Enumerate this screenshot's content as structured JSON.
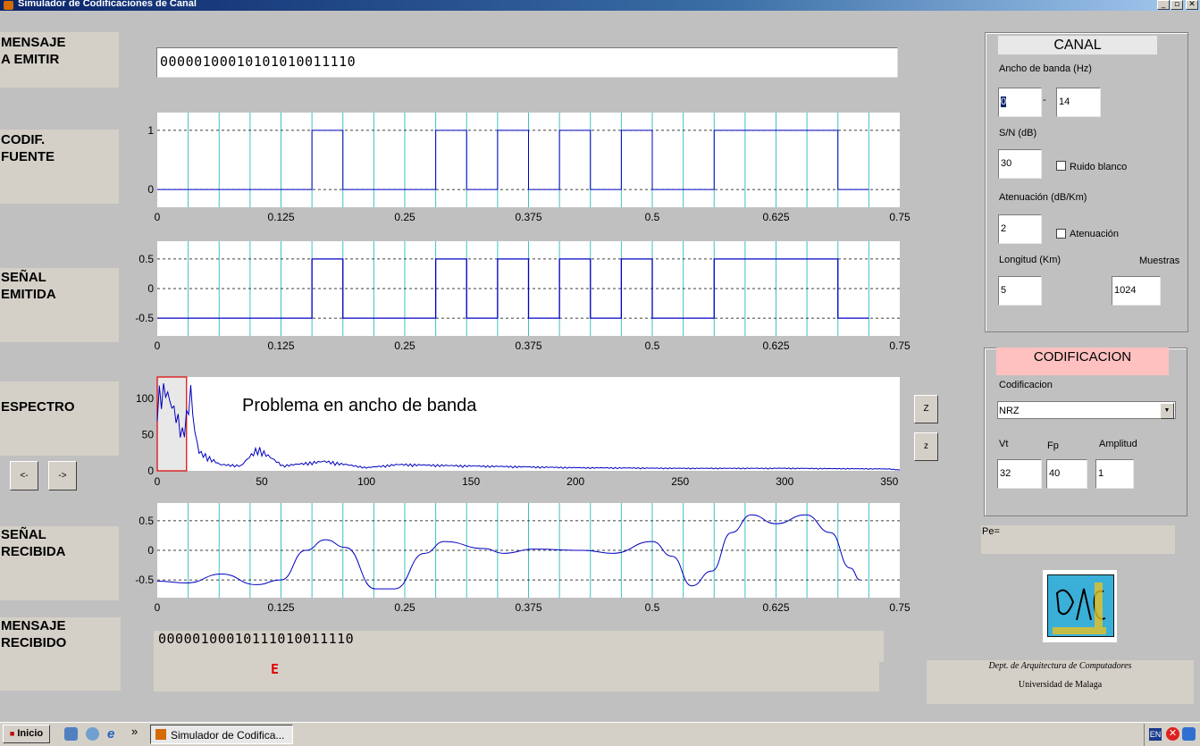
{
  "window": {
    "title": "Simulador de Codificaciones de Canal",
    "controls": [
      "_",
      "▫",
      "✕"
    ]
  },
  "left": {
    "mensaje_emitir": "MENSAJE\nA EMITIR",
    "codif_fuente": "CODIF.\nFUENTE",
    "senal_emitida": "SEÑAL\nEMITIDA",
    "espectro": "ESPECTRO",
    "senal_recibida": "SEÑAL\nRECIBIDA",
    "mensaje_recibido": "MENSAJE\nRECIBIDO",
    "prev_button": "<-",
    "next_button": "->"
  },
  "message_input": {
    "value": "00000100010101010011110"
  },
  "received": {
    "value": "00000100010111010011110",
    "error_mark": "E"
  },
  "plots": {
    "time_ticks": [
      "0",
      "0.125",
      "0.25",
      "0.375",
      "0.5",
      "0.625",
      "0.75"
    ],
    "codif_y_ticks": [
      "1",
      "0"
    ],
    "emit_y_ticks": [
      "0.5",
      "0",
      "-0.5"
    ],
    "spectrum_x_ticks": [
      "0",
      "50",
      "100",
      "150",
      "200",
      "250",
      "300",
      "350"
    ],
    "spectrum_y_ticks": [
      "100",
      "50",
      "0"
    ],
    "recv_y_ticks": [
      "0.5",
      "0",
      "-0.5"
    ],
    "annotation": "Problema en ancho de banda",
    "zoom_in": "Z",
    "zoom_out": "z"
  },
  "chart_data": [
    {
      "type": "line",
      "name": "codif-fuente",
      "step": true,
      "bits": [
        0,
        0,
        0,
        0,
        0,
        1,
        0,
        0,
        0,
        1,
        0,
        1,
        0,
        1,
        0,
        1,
        0,
        0,
        1,
        1,
        1,
        1,
        0
      ],
      "bit_duration": 0.03125,
      "ylim": [
        -0.3,
        1.3
      ],
      "xlim": [
        0,
        0.75
      ],
      "grid_y": [
        1,
        0
      ]
    },
    {
      "type": "line",
      "name": "senal-emitida",
      "step": true,
      "encoding": "NRZ",
      "levels": [
        -0.5,
        0.5
      ],
      "xlim": [
        0,
        0.75
      ],
      "ylim": [
        -0.8,
        0.8
      ]
    },
    {
      "type": "line",
      "name": "espectro",
      "xlim": [
        0,
        355
      ],
      "ylim": [
        0,
        130
      ],
      "band_highlight": [
        0,
        14
      ],
      "peaks": [
        [
          0,
          115
        ],
        [
          2,
          122
        ],
        [
          4,
          128
        ],
        [
          6,
          110
        ],
        [
          8,
          95
        ],
        [
          10,
          80
        ],
        [
          12,
          60
        ],
        [
          14,
          85
        ],
        [
          16,
          125
        ],
        [
          18,
          60
        ],
        [
          20,
          30
        ],
        [
          25,
          20
        ],
        [
          30,
          10
        ],
        [
          40,
          8
        ],
        [
          48,
          35
        ],
        [
          60,
          8
        ],
        [
          80,
          15
        ],
        [
          100,
          5
        ],
        [
          115,
          10
        ],
        [
          145,
          8
        ],
        [
          200,
          5
        ],
        [
          250,
          4
        ],
        [
          300,
          4
        ],
        [
          350,
          3
        ]
      ]
    },
    {
      "type": "line",
      "name": "senal-recibida",
      "xlim": [
        0,
        0.75
      ],
      "ylim": [
        -0.8,
        0.8
      ],
      "points": [
        [
          0,
          -0.52
        ],
        [
          0.03,
          -0.55
        ],
        [
          0.065,
          -0.4
        ],
        [
          0.1,
          -0.58
        ],
        [
          0.125,
          -0.5
        ],
        [
          0.15,
          0.0
        ],
        [
          0.17,
          0.18
        ],
        [
          0.19,
          0.05
        ],
        [
          0.22,
          -0.65
        ],
        [
          0.24,
          -0.65
        ],
        [
          0.27,
          -0.05
        ],
        [
          0.29,
          0.15
        ],
        [
          0.33,
          0.03
        ],
        [
          0.35,
          -0.05
        ],
        [
          0.38,
          0.02
        ],
        [
          0.43,
          0.0
        ],
        [
          0.46,
          -0.05
        ],
        [
          0.5,
          0.15
        ],
        [
          0.52,
          -0.1
        ],
        [
          0.54,
          -0.6
        ],
        [
          0.56,
          -0.35
        ],
        [
          0.58,
          0.3
        ],
        [
          0.6,
          0.6
        ],
        [
          0.625,
          0.45
        ],
        [
          0.655,
          0.6
        ],
        [
          0.68,
          0.3
        ],
        [
          0.7,
          -0.3
        ],
        [
          0.71,
          -0.5
        ]
      ]
    }
  ],
  "canal": {
    "title": "CANAL",
    "bw_label": "Ancho de banda (Hz)",
    "bw_min": "0",
    "bw_sep": "-",
    "bw_max": "14",
    "sn_label": "S/N (dB)",
    "sn_value": "30",
    "ruido_label": "Ruido blanco",
    "aten_label": "Atenuación (dB/Km)",
    "aten_value": "2",
    "aten_check_label": "Atenuación",
    "long_label": "Longitud (Km)",
    "long_value": "5",
    "muestras_label": "Muestras",
    "muestras_value": "1024"
  },
  "codificacion": {
    "title": "CODIFICACION",
    "cod_label": "Codificacion",
    "cod_value": "NRZ",
    "vt_label": "Vt",
    "vt_value": "32",
    "fp_label": "Fp",
    "fp_value": "40",
    "amp_label": "Amplitud",
    "amp_value": "1"
  },
  "pe_label": "Pe=",
  "dept": {
    "line1": "Dept. de Arquitectura de Computadores",
    "line2": "Universidad de Malaga"
  },
  "taskbar": {
    "start": "Inicio",
    "task": "Simulador de Codifica...",
    "lang": "EN",
    "chevron": "»"
  },
  "colors": {
    "signal": "#0000c0",
    "grid_teal": "#40c0c0",
    "highlight_red": "#e00000",
    "pink_title": "#ffc0c0"
  }
}
